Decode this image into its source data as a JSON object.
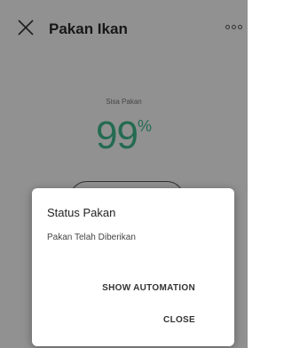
{
  "app_bar": {
    "title": "Pakan Ikan",
    "close_icon": "close-x-icon",
    "more_icon": "more-horizontal-icon"
  },
  "feed_status": {
    "label": "Sisa Pakan",
    "value": "99",
    "unit": "%",
    "accent_color": "#3fb88c"
  },
  "dialog": {
    "title": "Status Pakan",
    "message": "Pakan Telah Diberikan",
    "show_automation_label": "SHOW AUTOMATION",
    "close_label": "CLOSE"
  }
}
